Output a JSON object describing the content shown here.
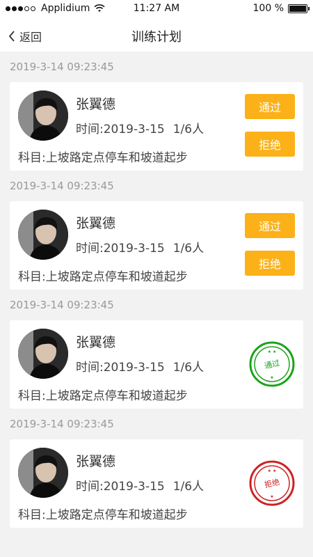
{
  "status_bar": {
    "carrier": "Applidium",
    "time": "11:27 AM",
    "battery": "100 %"
  },
  "nav": {
    "back_label": "返回",
    "title": "训练计划"
  },
  "colors": {
    "accent": "#fbb117",
    "approved_stamp": "#1aa31a",
    "rejected_stamp": "#cc2222"
  },
  "requests": [
    {
      "date": "2019-3-14    09:23:45",
      "name": "张翼德",
      "time_prefix": "时间:",
      "time": "2019-3-15",
      "count": "1/6人",
      "subject": "科目:上坡路定点停车和坡道起步",
      "approve_label": "通过",
      "reject_label": "拒绝"
    },
    {
      "date": "2019-3-14    09:23:45",
      "name": "张翼德",
      "time_prefix": "时间:",
      "time": "2019-3-15",
      "count": "1/6人",
      "subject": "科目:上坡路定点停车和坡道起步",
      "approve_label": "通过",
      "reject_label": "拒绝"
    },
    {
      "date": "2019-3-14    09:23:45",
      "name": "张翼德",
      "time_prefix": "时间:",
      "time": "2019-3-15",
      "count": "1/6人",
      "subject": "科目:上坡路定点停车和坡道起步",
      "stamp_label": "通过"
    },
    {
      "date": "2019-3-14    09:23:45",
      "name": "张翼德",
      "time_prefix": "时间:",
      "time": "2019-3-15",
      "count": "1/6人",
      "subject": "科目:上坡路定点停车和坡道起步",
      "stamp_label": "拒绝"
    }
  ]
}
